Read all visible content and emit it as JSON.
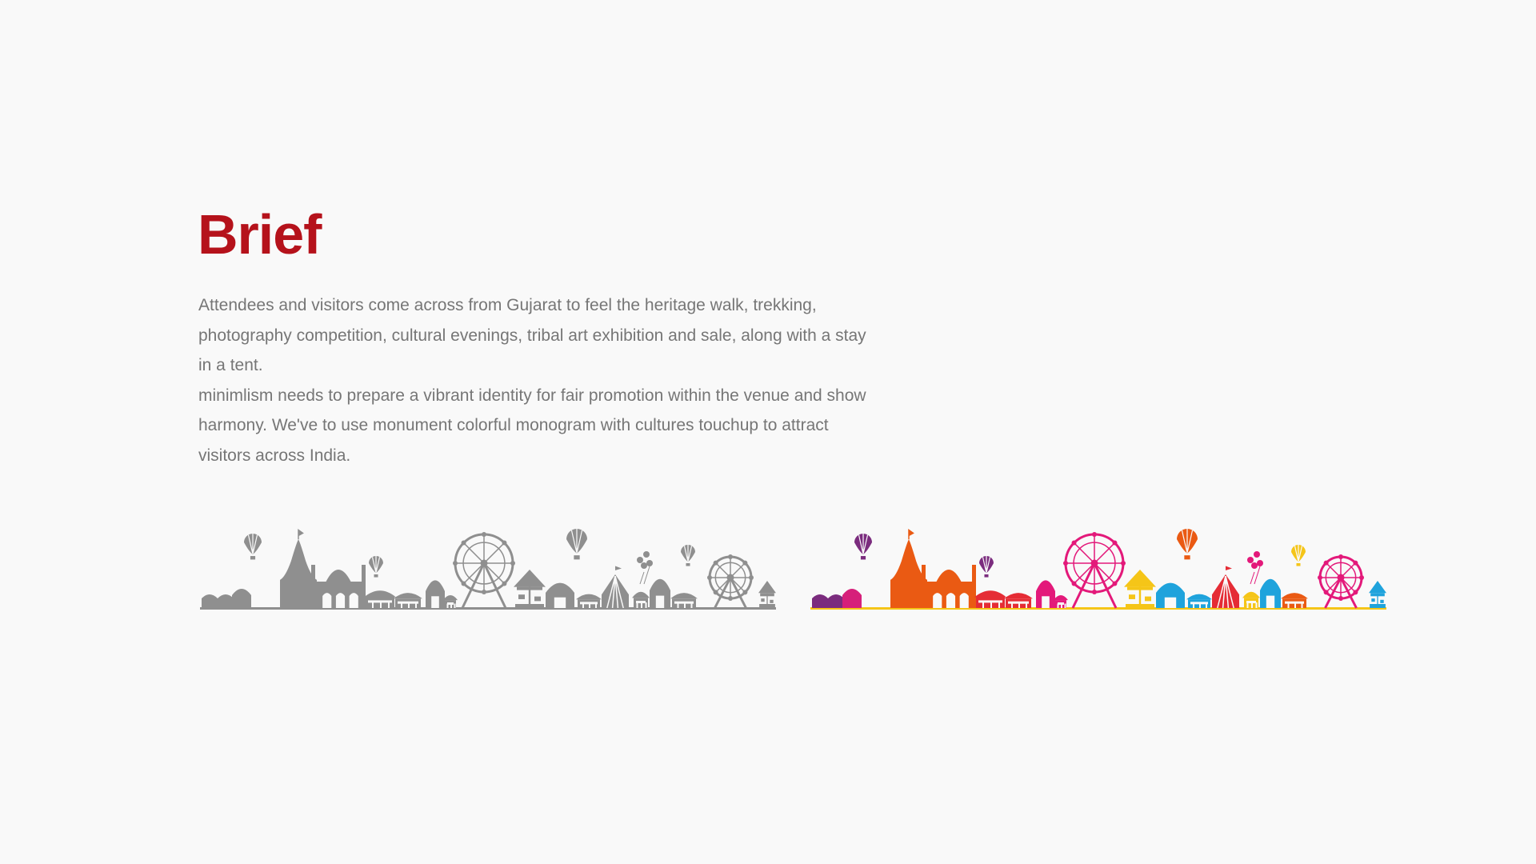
{
  "title": "Brief",
  "paragraphs": [
    "Attendees and visitors come across from Gujarat to feel the heritage walk, trekking, photography competition, cultural evenings, tribal art exhibition and sale, along with a stay in a tent.",
    "minimlism needs to prepare a vibrant identity for fair promotion within the venue and show harmony. We've to use monument colorful monogram with cultures touchup to attract visitors across India."
  ],
  "colors": {
    "title": "#b5121b",
    "body_text": "#767676",
    "background": "#f9f9f9",
    "monochrome": "#8f8f8f",
    "palette": {
      "purple": "#7b2c7e",
      "magenta": "#d6207a",
      "orange": "#ea5a13",
      "red": "#e52c35",
      "pink": "#e3197a",
      "cyan": "#1fa3dc",
      "yellow": "#f5c518",
      "blue": "#1478be"
    }
  },
  "illustrations": [
    {
      "name": "skyline-monochrome",
      "style": "grayscale"
    },
    {
      "name": "skyline-colored",
      "style": "multicolor"
    }
  ]
}
